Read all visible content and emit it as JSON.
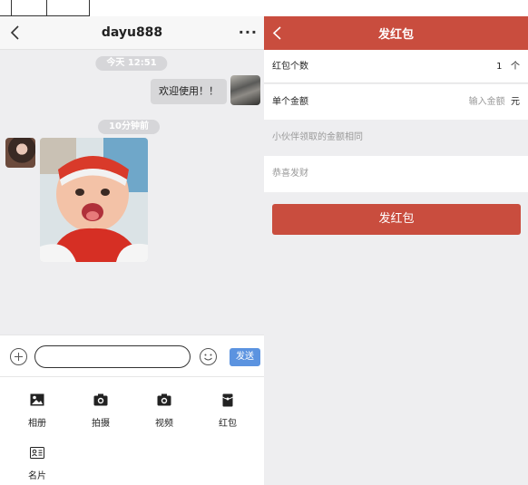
{
  "chat": {
    "title": "dayu888",
    "more": "···",
    "time1": "今天 12:51",
    "message1": "欢迎使用！！",
    "time2": "10分钟前",
    "send_label": "发送",
    "input_value": ""
  },
  "tools": [
    {
      "label": "相册",
      "icon": "album-icon"
    },
    {
      "label": "拍摄",
      "icon": "camera-icon"
    },
    {
      "label": "视频",
      "icon": "video-icon"
    },
    {
      "label": "红包",
      "icon": "red-packet-icon"
    },
    {
      "label": "名片",
      "icon": "card-icon"
    }
  ],
  "redpacket": {
    "title": "发红包",
    "count_label": "红包个数",
    "count_value": "1",
    "count_unit": "个",
    "amount_label": "单个金额",
    "amount_placeholder": "输入金额",
    "amount_unit": "元",
    "hint": "小伙伴领取的金额相同",
    "greeting_placeholder": "恭喜发财",
    "submit_label": "发红包"
  },
  "colors": {
    "accent_red": "#c94d3e",
    "send_blue": "#5b93e0",
    "bg_grey": "#eeeef0"
  }
}
